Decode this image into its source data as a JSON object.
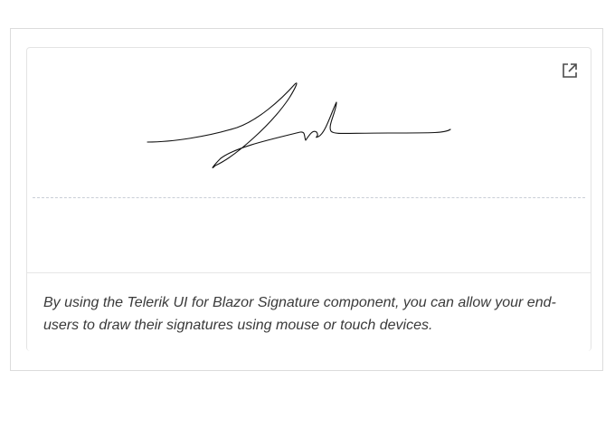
{
  "signature": {
    "maximize_icon": "external-link-icon"
  },
  "description": {
    "text": "By using the Telerik UI for Blazor Signature component, you can allow your end-users to draw their signatures using mouse or touch devices."
  }
}
